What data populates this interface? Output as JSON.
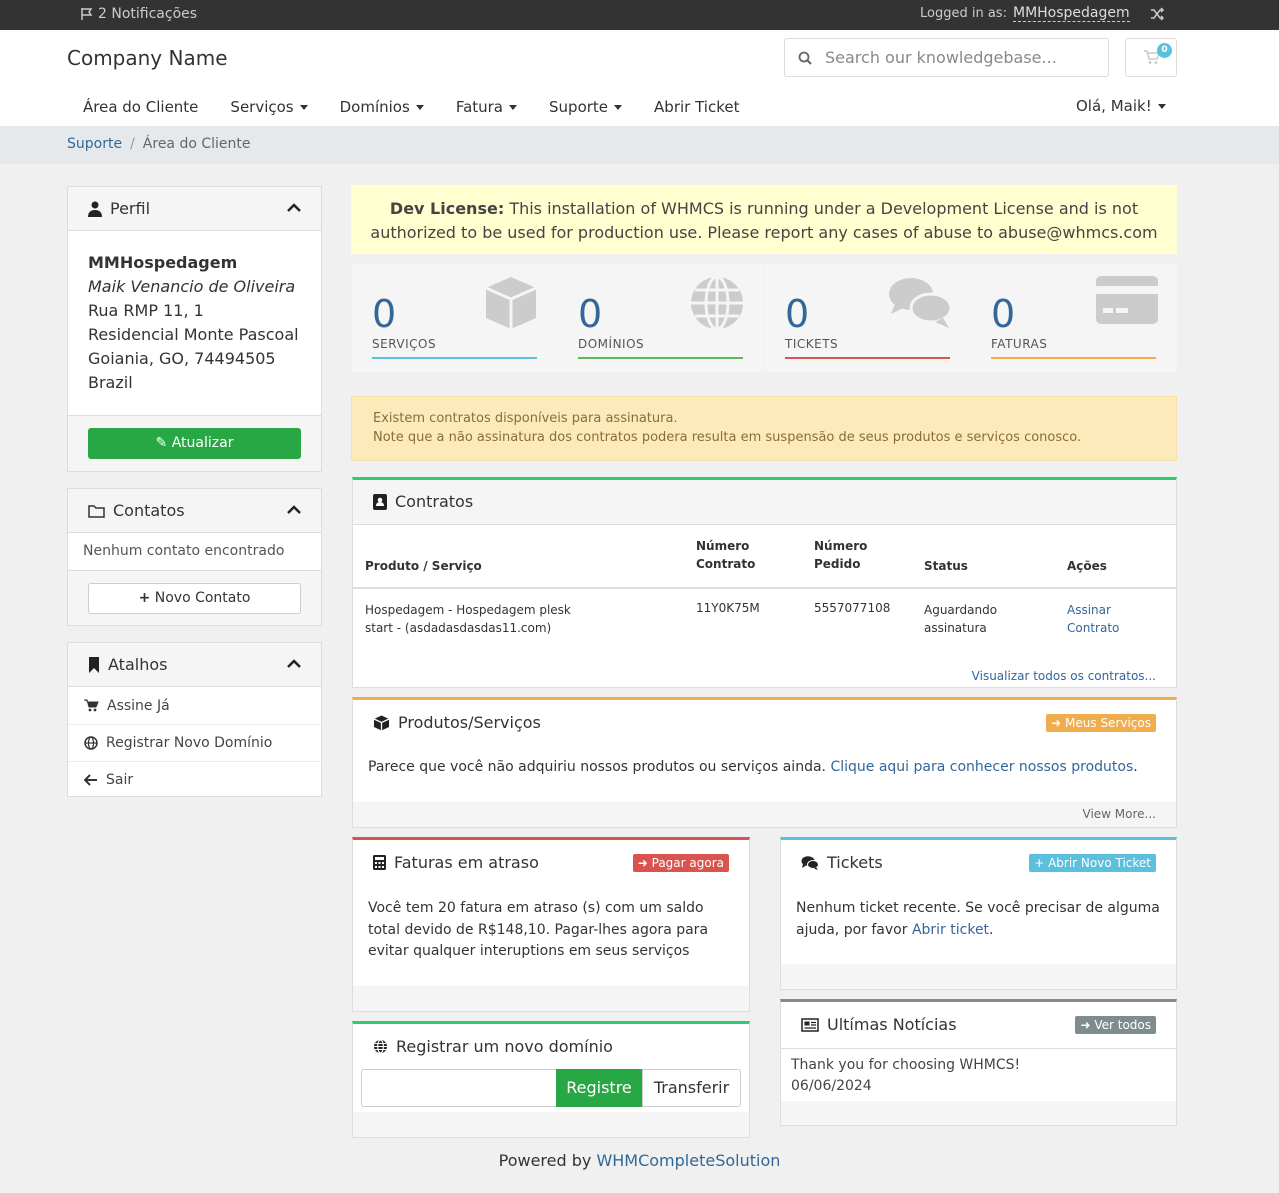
{
  "topbar": {
    "notifications": "2 Notificações",
    "logged_in_label": "Logged in as:",
    "username": "MMHospedagem"
  },
  "header": {
    "company": "Company Name",
    "search_placeholder": "Search our knowledgebase...",
    "cart_count": "0"
  },
  "nav": {
    "items": [
      "Área do Cliente",
      "Serviços",
      "Domínios",
      "Fatura",
      "Suporte",
      "Abrir Ticket"
    ],
    "greeting": "Olá, Maik!"
  },
  "breadcrumb": {
    "link": "Suporte",
    "separator": "/",
    "current": "Área do Cliente"
  },
  "profile": {
    "title": "Perfil",
    "company": "MMHospedagem",
    "name": "Maik Venancio de Oliveira",
    "address1": "Rua RMP 11, 1",
    "address2": "Residencial Monte Pascoal",
    "city": "Goiania, GO, 74494505",
    "country": "Brazil",
    "update_btn": "Atualizar"
  },
  "contacts": {
    "title": "Contatos",
    "empty": "Nenhum contato encontrado",
    "new_btn": "Novo Contato"
  },
  "shortcuts": {
    "title": "Atalhos",
    "items": [
      "Assine Já",
      "Registrar Novo Domínio",
      "Sair"
    ]
  },
  "dev_license": {
    "bold": "Dev License:",
    "text": "This installation of WHMCS is running under a Development License and is not authorized to be used for production use. Please report any cases of abuse to abuse@whmcs.com"
  },
  "tiles": [
    {
      "count": "0",
      "label": "SERVIÇOS",
      "color": "#5bc0de"
    },
    {
      "count": "0",
      "label": "DOMÍNIOS",
      "color": "#5cb85c"
    },
    {
      "count": "0",
      "label": "TICKETS",
      "color": "#d9534f"
    },
    {
      "count": "0",
      "label": "FATURAS",
      "color": "#f0ad4e"
    }
  ],
  "warning": {
    "line1": "Existem contratos disponíveis para assinatura.",
    "line2": "Note que a não assinatura dos contratos podera resulta em suspensão de seus produtos e serviços conosco."
  },
  "contracts": {
    "title": "Contratos",
    "headers": [
      "Produto / Serviço",
      "Número Contrato",
      "Número Pedido",
      "Status",
      "Ações"
    ],
    "rows": [
      [
        "Hospedagem - Hospedagem plesk start - (asdadasdasdas11.com)",
        "11Y0K75M",
        "5557077108",
        "Aguardando assinatura",
        "Assinar Contrato"
      ]
    ],
    "view_all": "Visualizar todos os contratos..."
  },
  "products": {
    "title": "Produtos/Serviços",
    "btn": "Meus Serviços",
    "text": "Parece que você não adquiriu nossos produtos ou serviços ainda.",
    "link": "Clique aqui para conhecer nossos produtos",
    "after": ".",
    "more": "View More..."
  },
  "invoices": {
    "title": "Faturas em atraso",
    "btn": "Pagar agora",
    "text": "Você tem 20 fatura em atraso (s) com um saldo total devido de R$148,10. Pagar-lhes agora para evitar qualquer interuptions em seus serviços"
  },
  "tickets": {
    "title": "Tickets",
    "btn": "Abrir Novo Ticket",
    "text": "Nenhum ticket recente. Se você precisar de alguma ajuda, por favor",
    "link": "Abrir ticket",
    "after": "."
  },
  "domain": {
    "title": "Registrar um novo domínio",
    "register_btn": "Registre",
    "transfer_btn": "Transferir"
  },
  "news": {
    "title": "Ultímas Notícias",
    "btn": "Ver todos",
    "item_title": "Thank you for choosing WHMCS!",
    "item_date": "06/06/2024"
  },
  "footer": {
    "prefix": "Powered by",
    "link": "WHMCompleteSolution"
  }
}
